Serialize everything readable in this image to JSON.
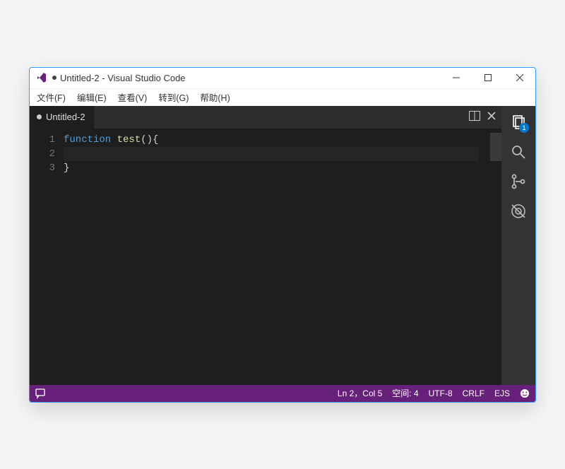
{
  "window": {
    "title": "Untitled-2 - Visual Studio Code",
    "dirty": true
  },
  "menubar": {
    "items": [
      {
        "label": "文件(F)"
      },
      {
        "label": "编辑(E)"
      },
      {
        "label": "查看(V)"
      },
      {
        "label": "转到(G)"
      },
      {
        "label": "帮助(H)"
      }
    ]
  },
  "tabs": {
    "active": {
      "label": "Untitled-2",
      "dirty": true
    }
  },
  "editor": {
    "lines": [
      {
        "num": "1",
        "code_html": "<span class='kw'>function</span> <span class='fn'>test</span><span class='pn'>(){</span>"
      },
      {
        "num": "2",
        "code_html": ""
      },
      {
        "num": "3",
        "code_html": "<span class='pn'>}</span>"
      }
    ],
    "active_line_index": 1
  },
  "activitybar": {
    "explorer_badge": "1"
  },
  "statusbar": {
    "cursor": "Ln 2，Col 5",
    "spaces": "空间: 4",
    "encoding": "UTF-8",
    "eol": "CRLF",
    "lang": "EJS"
  }
}
